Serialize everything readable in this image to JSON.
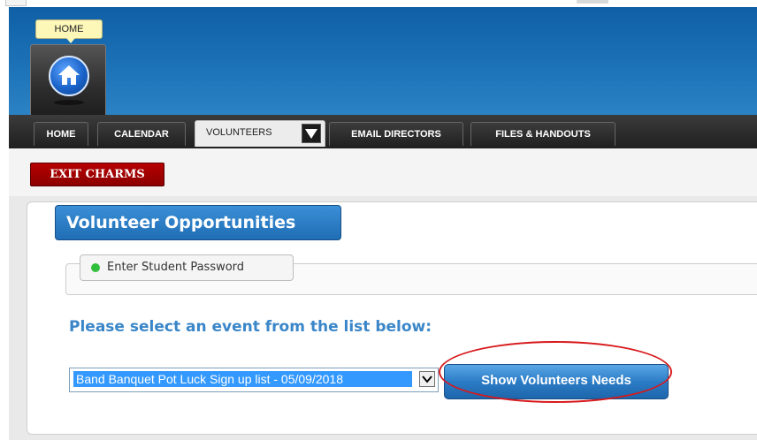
{
  "header": {
    "home_tooltip": "HOME"
  },
  "nav": {
    "tabs": [
      {
        "label": "HOME"
      },
      {
        "label": "CALENDAR"
      },
      {
        "label": "VOLUNTEERS"
      },
      {
        "label": "EMAIL DIRECTORS"
      },
      {
        "label": "FILES & HANDOUTS"
      }
    ],
    "active_tab": "VOLUNTEERS"
  },
  "subbar": {
    "exit_label": "EXIT CHARMS"
  },
  "panel": {
    "title": "Volunteer Opportunities",
    "password_label": "Enter Student Password",
    "select_heading": "Please select an event from the list below:",
    "event_selected": "Band Banquet Pot Luck Sign up list - 05/09/2018",
    "show_button": "Show Volunteers Needs"
  },
  "colors": {
    "header_blue": "#1a6fb4",
    "exit_red": "#a00000",
    "heading_blue": "#3a86c8",
    "highlight": "#d7191c"
  },
  "icons": {
    "home": "house-icon",
    "select_arrow": "chevron-down-icon",
    "tab_menu": "caret-down-icon"
  }
}
